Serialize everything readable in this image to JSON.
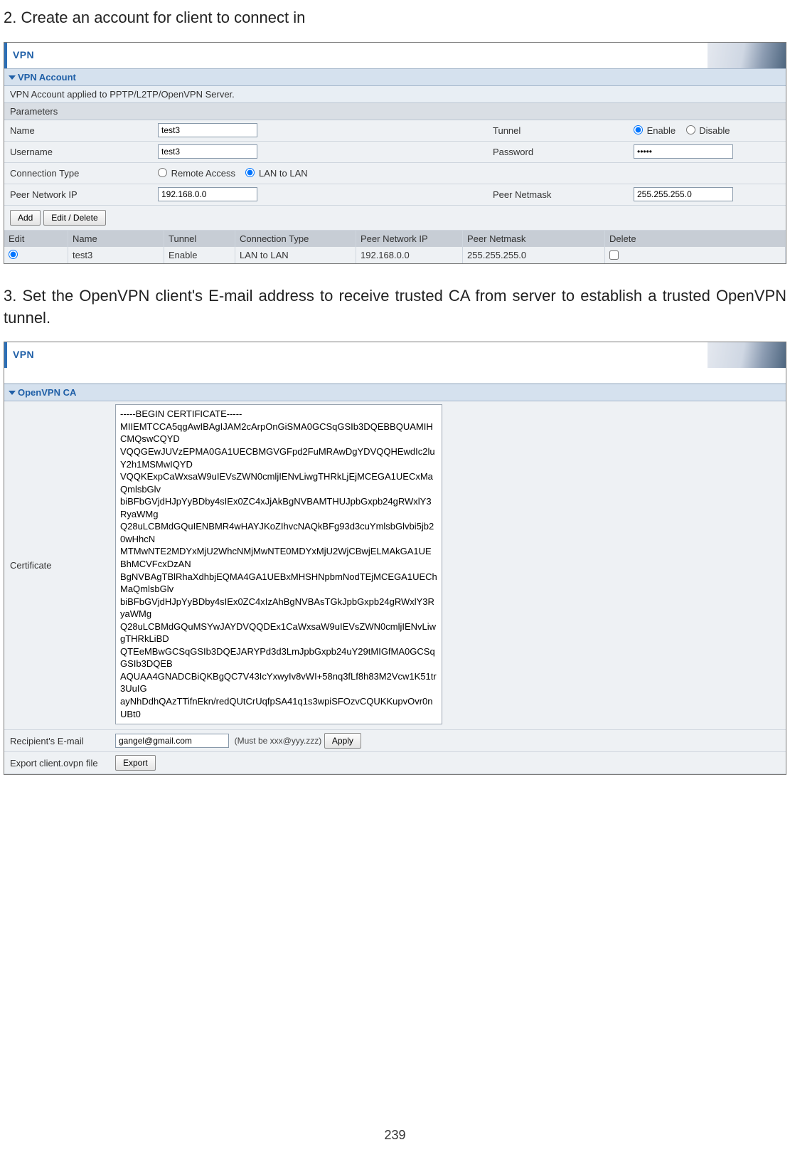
{
  "steps": {
    "s2": "2. Create an account for client to connect in",
    "s3": "3. Set the OpenVPN client's E-mail address to receive trusted CA from server to establish a trusted OpenVPN tunnel."
  },
  "panel1": {
    "tab": "VPN",
    "section": "VPN Account",
    "info": "VPN Account applied to PPTP/L2TP/OpenVPN Server.",
    "parameters_label": "Parameters",
    "labels": {
      "name": "Name",
      "tunnel": "Tunnel",
      "enable": "Enable",
      "disable": "Disable",
      "username": "Username",
      "password": "Password",
      "connection_type": "Connection Type",
      "remote_access": "Remote Access",
      "lan_to_lan": "LAN to LAN",
      "peer_network_ip": "Peer Network IP",
      "peer_netmask": "Peer Netmask",
      "add": "Add",
      "edit_delete": "Edit / Delete"
    },
    "values": {
      "name": "test3",
      "username": "test3",
      "password": "•••••",
      "peer_network_ip": "192.168.0.0",
      "peer_netmask": "255.255.255.0"
    },
    "table": {
      "headers": {
        "edit": "Edit",
        "name": "Name",
        "tunnel": "Tunnel",
        "connection_type": "Connection Type",
        "peer_network_ip": "Peer Network IP",
        "peer_netmask": "Peer Netmask",
        "delete": "Delete"
      },
      "row0": {
        "name": "test3",
        "tunnel": "Enable",
        "connection_type": "LAN to LAN",
        "peer_network_ip": "192.168.0.0",
        "peer_netmask": "255.255.255.0"
      }
    }
  },
  "panel2": {
    "tab": "VPN",
    "section": "OpenVPN CA",
    "labels": {
      "certificate": "Certificate",
      "recipient_email": "Recipient's E-mail",
      "hint": "(Must be xxx@yyy.zzz)",
      "apply": "Apply",
      "export_row": "Export client.ovpn file",
      "export_btn": "Export"
    },
    "values": {
      "email": "gangel@gmail.com",
      "certificate": "-----BEGIN CERTIFICATE-----\nMIIEMTCCA5qgAwIBAgIJAM2cArpOnGiSMA0GCSqGSIb3DQEBBQUAMIHCMQswCQYD\nVQQGEwJUVzEPMA0GA1UECBMGVGFpd2FuMRAwDgYDVQQHEwdIc2luY2h1MSMwIQYD\nVQQKExpCaWxsaW9uIEVsZWN0cmljIENvLiwgTHRkLjEjMCEGA1UECxMaQmlsbGlv\nbiBFbGVjdHJpYyBDby4sIEx0ZC4xJjAkBgNVBAMTHUJpbGxpb24gRWxlY3RyaWMg\nQ28uLCBMdGQuIENBMR4wHAYJKoZIhvcNAQkBFg93d3cuYmlsbGlvbi5jb20wHhcN\nMTMwNTE2MDYxMjU2WhcNMjMwNTE0MDYxMjU2WjCBwjELMAkGA1UEBhMCVFcxDzAN\nBgNVBAgTBlRhaXdhbjEQMA4GA1UEBxMHSHNpbmNodTEjMCEGA1UEChMaQmlsbGlv\nbiBFbGVjdHJpYyBDby4sIEx0ZC4xIzAhBgNVBAsTGkJpbGxpb24gRWxlY3RyaWMg\nQ28uLCBMdGQuMSYwJAYDVQQDEx1CaWxsaW9uIEVsZWN0cmljIENvLiwgTHRkLiBD\nQTEeMBwGCSqGSIb3DQEJARYPd3d3LmJpbGxpb24uY29tMIGfMA0GCSqGSIb3DQEB\nAQUAA4GNADCBiQKBgQC7V43IcYxwyIv8vWI+58nq3fLf8h83M2Vcw1K51tr3UuIG\nayNhDdhQAzTTifnEkn/redQUtCrUqfpSA41q1s3wpiSFOzvCQUKKupvOvr0nUBt0"
    }
  },
  "page_number": "239"
}
